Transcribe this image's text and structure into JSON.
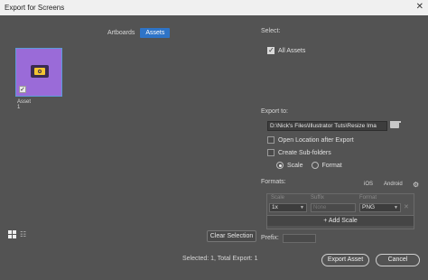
{
  "window": {
    "title": "Export for Screens",
    "close_glyph": "✕"
  },
  "tabs": [
    {
      "label": "Artboards",
      "active": false
    },
    {
      "label": "Assets",
      "active": true
    }
  ],
  "assets": [
    {
      "label": "Asset 1",
      "checked": true
    }
  ],
  "view_icons": [
    "grid-view-icon",
    "list-view-icon"
  ],
  "list_icon_glyph": "☷",
  "clear_selection_label": "Clear Selection",
  "status_text": "Selected: 1, Total Export: 1",
  "select": {
    "label": "Select:",
    "all_assets_label": "All Assets",
    "all_assets_checked": true
  },
  "export_to": {
    "label": "Export to:",
    "path": "D:\\Nick's Files\\Illustrator Tuts\\Resize Ima",
    "open_location_label": "Open Location after Export",
    "open_location_checked": false,
    "create_subfolders_label": "Create Sub-folders",
    "create_subfolders_checked": false,
    "scale_label": "Scale",
    "format_label": "Format",
    "selected_mode": "Scale"
  },
  "formats": {
    "label": "Formats:",
    "ios_label": "iOS",
    "android_label": "Android",
    "columns": {
      "scale": "Scale",
      "suffix": "Suffix",
      "format": "Format"
    },
    "rows": [
      {
        "scale": "1x",
        "suffix": "None",
        "format": "PNG"
      }
    ],
    "add_scale_label": "+ Add Scale",
    "gear_glyph": "⚙",
    "dropdown_glyph": "▼",
    "remove_glyph": "✕"
  },
  "prefix": {
    "label": "Prefix:",
    "value": ""
  },
  "buttons": {
    "export": "Export Asset",
    "cancel": "Cancel"
  },
  "colors": {
    "accent": "#2e74c7",
    "panel": "#535353",
    "thumbnail": "#9a6bd8"
  }
}
